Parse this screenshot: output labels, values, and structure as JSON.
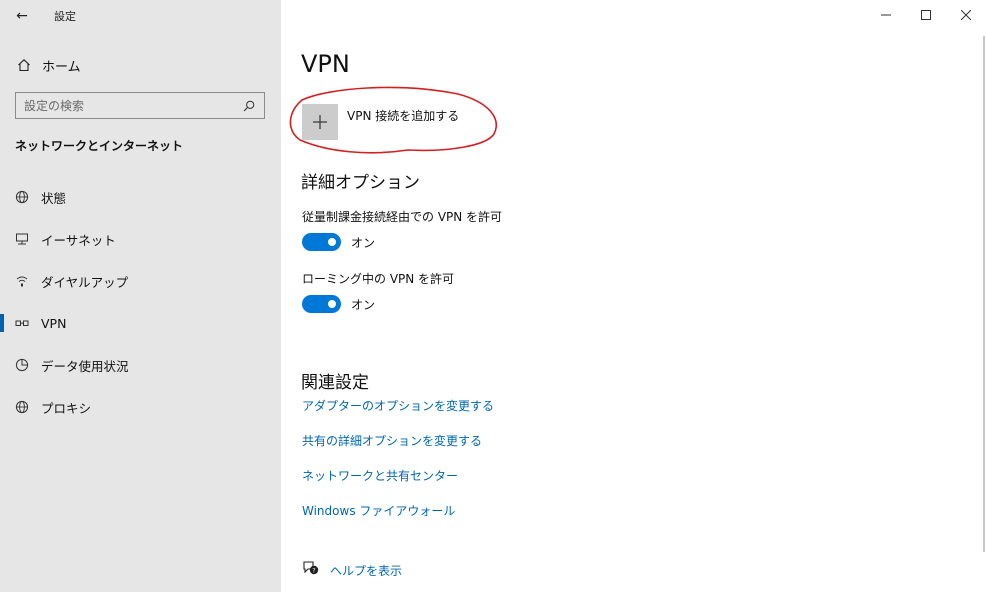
{
  "window": {
    "app_title": "設定",
    "back_glyph": "←"
  },
  "sidebar": {
    "home_label": "ホーム",
    "search_placeholder": "設定の検索",
    "section_title": "ネットワークとインターネット",
    "items": [
      {
        "label": "状態",
        "icon": "globe-status-icon"
      },
      {
        "label": "イーサネット",
        "icon": "ethernet-icon"
      },
      {
        "label": "ダイヤルアップ",
        "icon": "dialup-icon"
      },
      {
        "label": "VPN",
        "icon": "vpn-icon",
        "selected": true
      },
      {
        "label": "データ使用状況",
        "icon": "data-usage-icon"
      },
      {
        "label": "プロキシ",
        "icon": "globe-proxy-icon"
      }
    ]
  },
  "main": {
    "title": "VPN",
    "add_vpn_label": "VPN 接続を追加する",
    "advanced_title": "詳細オプション",
    "options": [
      {
        "label": "従量制課金接続経由での VPN を許可",
        "state": "オン",
        "on": true
      },
      {
        "label": "ローミング中の VPN を許可",
        "state": "オン",
        "on": true
      }
    ],
    "related_title": "関連設定",
    "related_links": [
      "アダプターのオプションを変更する",
      "共有の詳細オプションを変更する",
      "ネットワークと共有センター",
      "Windows ファイアウォール"
    ],
    "help_label": "ヘルプを表示"
  },
  "colors": {
    "accent": "#0078d7",
    "link": "#0066b4",
    "annotation": "#d42020",
    "sidebar_bg": "#e6e6e6"
  }
}
